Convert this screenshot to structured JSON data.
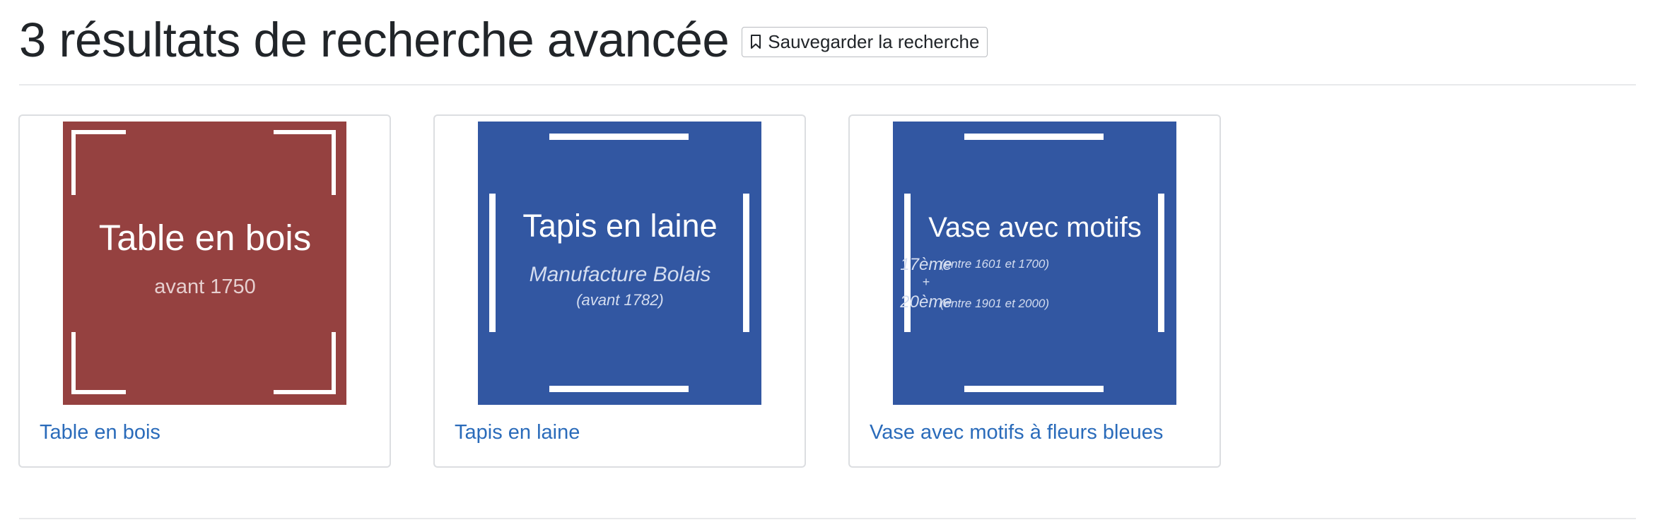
{
  "header": {
    "title": "3 résultats de recherche avancée",
    "save_button_label": "Sauvegarder la recherche",
    "save_button_icon": "bookmark-icon"
  },
  "colors": {
    "red_thumbnail": "#954140",
    "blue_thumbnail": "#3257a2",
    "link": "#2a6bba"
  },
  "results": [
    {
      "link_text": "Table en bois",
      "thumbnail": {
        "title": "Table en bois",
        "subtitle": "avant 1750"
      }
    },
    {
      "link_text": "Tapis en laine",
      "thumbnail": {
        "title": "Tapis en laine",
        "subtitle": "Manufacture Bolais",
        "note": "(avant 1782)"
      }
    },
    {
      "link_text": "Vase avec motifs à fleurs bleues",
      "thumbnail": {
        "title": "Vase avec motifs",
        "century_1": "17ème",
        "range_1": "(entre 1601 et 1700)",
        "plus": "+",
        "century_2": "20ème",
        "range_2": "(entre 1901 et 2000)"
      }
    }
  ]
}
